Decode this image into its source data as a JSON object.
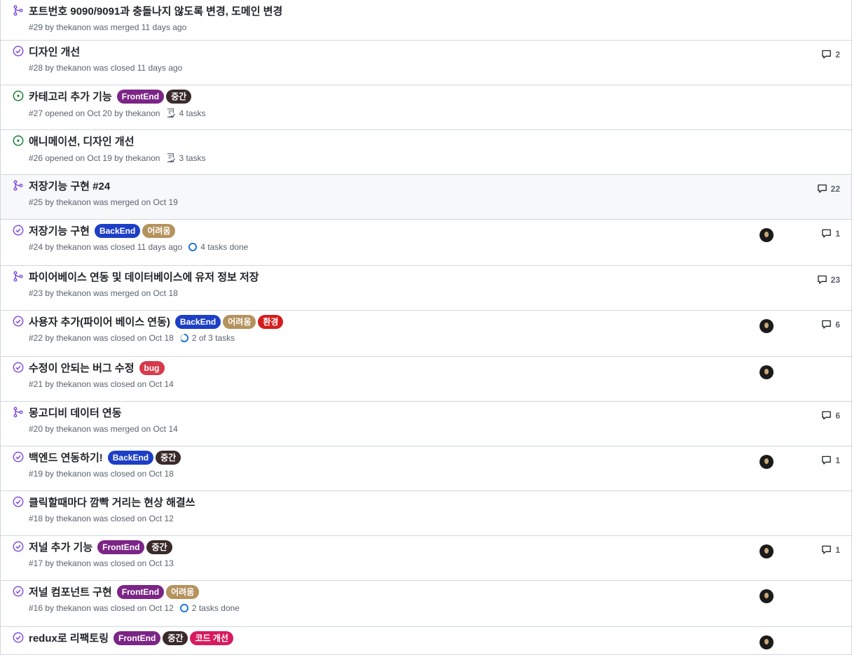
{
  "rows": [
    {
      "state": "merged",
      "title": "포트번호 9090/9091과 충돌나지 않도록 변경, 도메인 변경",
      "meta": "#29 by thekanon was merged 11 days ago",
      "labels": [],
      "tasks": "",
      "comments": "",
      "avatar": false
    },
    {
      "state": "closed",
      "title": "디자인 개선",
      "meta": "#28 by thekanon was closed 11 days ago",
      "labels": [],
      "tasks": "",
      "comments": "2",
      "avatar": false
    },
    {
      "state": "open",
      "title": "카테고리 추가 기능",
      "meta": "#27 opened on Oct 20 by thekanon",
      "labels": [
        {
          "name": "FrontEnd",
          "color": "#7b2586"
        },
        {
          "name": "중간",
          "color": "#3a2a2a"
        }
      ],
      "tasks": "4 tasks",
      "task_icon": "checklist",
      "comments": "",
      "avatar": false
    },
    {
      "state": "open",
      "title": "애니메이션, 디자인 개선",
      "meta": "#26 opened on Oct 19 by thekanon",
      "labels": [],
      "tasks": "3 tasks",
      "task_icon": "checklist",
      "comments": "",
      "avatar": false
    },
    {
      "state": "merged",
      "title": "저장기능 구현 #24",
      "meta": "#25 by thekanon was merged on Oct 19",
      "labels": [],
      "tasks": "",
      "comments": "22",
      "avatar": false
    },
    {
      "state": "closed",
      "title": "저장기능 구현",
      "meta": "#24 by thekanon was closed 11 days ago",
      "labels": [
        {
          "name": "BackEnd",
          "color": "#1d3fc5"
        },
        {
          "name": "어려움",
          "color": "#b5935e"
        }
      ],
      "tasks": "4 tasks done",
      "task_icon": "circle",
      "comments": "1",
      "avatar": true
    },
    {
      "state": "merged",
      "title": "파이어베이스 연동 및 데이터베이스에 유저 정보 저장",
      "meta": "#23 by thekanon was merged on Oct 18",
      "labels": [],
      "tasks": "",
      "comments": "23",
      "avatar": false
    },
    {
      "state": "closed",
      "title": "사용자 추가(파이어 베이스 연동)",
      "meta": "#22 by thekanon was closed on Oct 18",
      "labels": [
        {
          "name": "BackEnd",
          "color": "#1d3fc5"
        },
        {
          "name": "어려움",
          "color": "#b5935e"
        },
        {
          "name": "환경",
          "color": "#d41d1d"
        }
      ],
      "tasks": "2 of 3 tasks",
      "task_icon": "progress",
      "comments": "6",
      "avatar": true
    },
    {
      "state": "closed",
      "title": "수정이 안되는 버그 수정",
      "meta": "#21 by thekanon was closed on Oct 14",
      "labels": [
        {
          "name": "bug",
          "color": "#d73a4a"
        }
      ],
      "tasks": "",
      "comments": "",
      "avatar": true
    },
    {
      "state": "merged",
      "title": "몽고디비 데이터 연동",
      "meta": "#20 by thekanon was merged on Oct 14",
      "labels": [],
      "tasks": "",
      "comments": "6",
      "avatar": false
    },
    {
      "state": "closed",
      "title": "백엔드 연동하기!",
      "meta": "#19 by thekanon was closed on Oct 18",
      "labels": [
        {
          "name": "BackEnd",
          "color": "#1d3fc5"
        },
        {
          "name": "중간",
          "color": "#3a2a2a"
        }
      ],
      "tasks": "",
      "comments": "1",
      "avatar": true
    },
    {
      "state": "closed",
      "title": "클릭할때마다 깜빡 거리는 현상 해결쓰",
      "meta": "#18 by thekanon was closed on Oct 12",
      "labels": [],
      "tasks": "",
      "comments": "",
      "avatar": false
    },
    {
      "state": "closed",
      "title": "저널 추가 기능",
      "meta": "#17 by thekanon was closed on Oct 13",
      "labels": [
        {
          "name": "FrontEnd",
          "color": "#7b2586"
        },
        {
          "name": "중간",
          "color": "#3a2a2a"
        }
      ],
      "tasks": "",
      "comments": "1",
      "avatar": true
    },
    {
      "state": "closed",
      "title": "저널 컴포넌트 구현",
      "meta": "#16 by thekanon was closed on Oct 12",
      "labels": [
        {
          "name": "FrontEnd",
          "color": "#7b2586"
        },
        {
          "name": "어려움",
          "color": "#b5935e"
        }
      ],
      "tasks": "2 tasks done",
      "task_icon": "circle",
      "comments": "",
      "avatar": true
    },
    {
      "state": "closed",
      "title": "redux로 리팩토링",
      "meta": "",
      "labels": [
        {
          "name": "FrontEnd",
          "color": "#7b2586"
        },
        {
          "name": "중간",
          "color": "#3a2a2a"
        },
        {
          "name": "코드 개선",
          "color": "#d81b60"
        }
      ],
      "tasks": "",
      "comments": "",
      "avatar": true
    }
  ],
  "colors": {
    "merged": "#8250df",
    "closed": "#8250df",
    "open": "#1a7f37",
    "meta": "#59636e",
    "border": "#d0d7de"
  }
}
